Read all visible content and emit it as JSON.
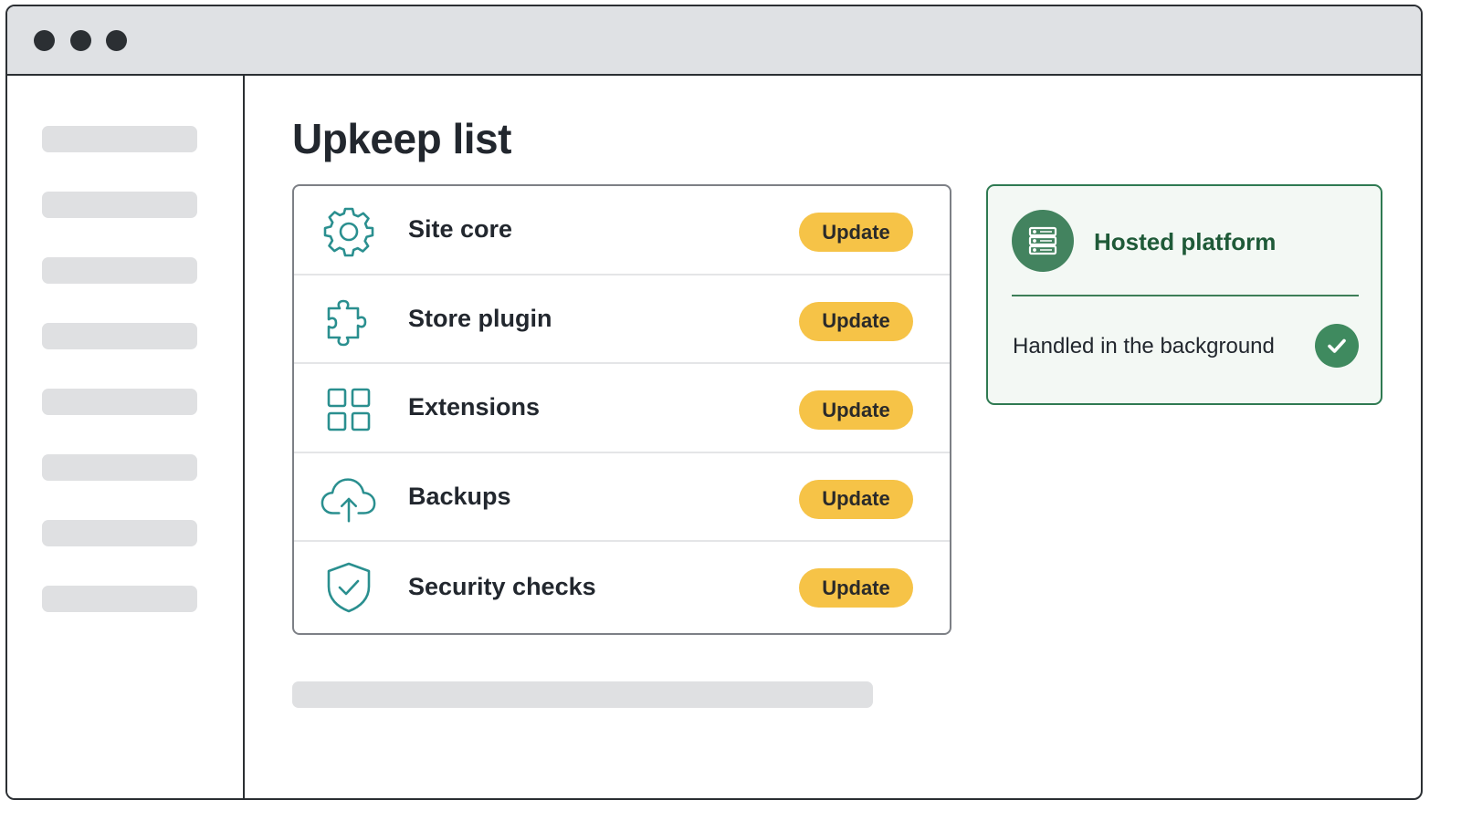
{
  "window": {
    "controls": [
      "dot",
      "dot",
      "dot"
    ]
  },
  "main": {
    "page_title": "Upkeep list",
    "items": [
      {
        "label": "Site core",
        "icon": "gear-icon",
        "action": "Update"
      },
      {
        "label": "Store plugin",
        "icon": "puzzle-piece-icon",
        "action": "Update"
      },
      {
        "label": "Extensions",
        "icon": "grid-icon",
        "action": "Update"
      },
      {
        "label": "Backups",
        "icon": "cloud-upload-icon",
        "action": "Update"
      },
      {
        "label": "Security checks",
        "icon": "shield-check-icon",
        "action": "Update"
      }
    ]
  },
  "hosted": {
    "title": "Hosted platform",
    "icon": "server-icon",
    "status": "Handled in the background",
    "status_icon": "checkmark-icon"
  },
  "colors": {
    "accent_button": "#f6c347",
    "icon_teal": "#2a8f8f",
    "hosted_green": "#43835f",
    "hosted_title": "#1f5a38",
    "skeleton": "#dfe0e2"
  }
}
